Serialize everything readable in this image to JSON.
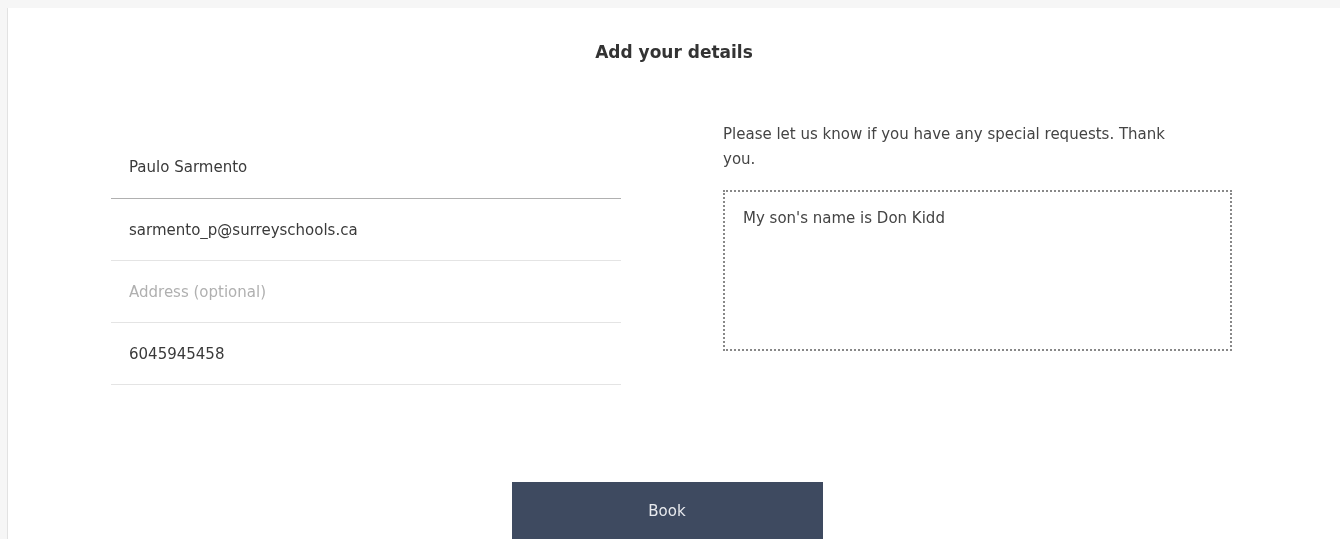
{
  "title": "Add your details",
  "fields": [
    {
      "value": "Paulo Sarmento",
      "focused": true
    },
    {
      "value": "sarmento_p@surreyschools.ca",
      "focused": false
    },
    {
      "placeholder": "Address (optional)",
      "focused": false
    },
    {
      "value": "6045945458",
      "focused": false
    }
  ],
  "requests": {
    "prompt": "Please let us know if you have any special requests. Thank you.",
    "value": "My son's name is Don Kidd"
  },
  "submit_button": "Book"
}
